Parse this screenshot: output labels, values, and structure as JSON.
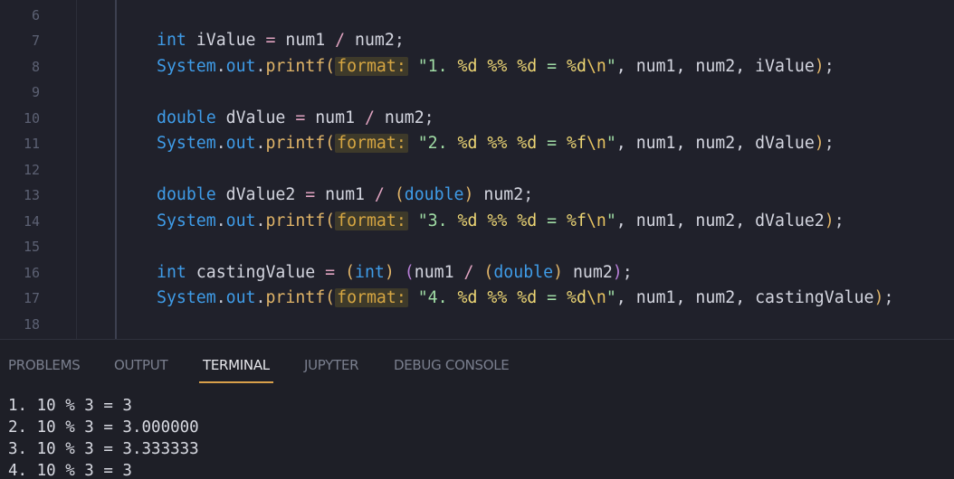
{
  "editor": {
    "lines": [
      {
        "num": "6",
        "tokens": []
      },
      {
        "num": "7",
        "tokens": [
          {
            "t": "int",
            "c": "kw"
          },
          {
            "t": " iValue ",
            "c": "var"
          },
          {
            "t": "=",
            "c": "op"
          },
          {
            "t": " num1 ",
            "c": "var"
          },
          {
            "t": "/",
            "c": "op"
          },
          {
            "t": " num2",
            "c": "var"
          },
          {
            "t": ";",
            "c": "plain"
          }
        ]
      },
      {
        "num": "8",
        "tokens": [
          {
            "t": "System",
            "c": "kw"
          },
          {
            "t": ".",
            "c": "plain"
          },
          {
            "t": "out",
            "c": "kw"
          },
          {
            "t": ".",
            "c": "plain"
          },
          {
            "t": "printf",
            "c": "method"
          },
          {
            "t": "(",
            "c": "p1"
          },
          {
            "t": "format:",
            "c": "hint"
          },
          {
            "t": " ",
            "c": "plain"
          },
          {
            "t": "\"1. ",
            "c": "str"
          },
          {
            "t": "%d",
            "c": "fmt"
          },
          {
            "t": " ",
            "c": "str"
          },
          {
            "t": "%%",
            "c": "fmt"
          },
          {
            "t": " ",
            "c": "str"
          },
          {
            "t": "%d",
            "c": "fmt"
          },
          {
            "t": " = ",
            "c": "str"
          },
          {
            "t": "%d",
            "c": "fmt"
          },
          {
            "t": "\\n",
            "c": "esc"
          },
          {
            "t": "\"",
            "c": "str"
          },
          {
            "t": ", num1, num2, iValue",
            "c": "var"
          },
          {
            "t": ")",
            "c": "p1"
          },
          {
            "t": ";",
            "c": "plain"
          }
        ]
      },
      {
        "num": "9",
        "tokens": []
      },
      {
        "num": "10",
        "tokens": [
          {
            "t": "double",
            "c": "kw"
          },
          {
            "t": " dValue ",
            "c": "var"
          },
          {
            "t": "=",
            "c": "op"
          },
          {
            "t": " num1 ",
            "c": "var"
          },
          {
            "t": "/",
            "c": "op"
          },
          {
            "t": " num2",
            "c": "var"
          },
          {
            "t": ";",
            "c": "plain"
          }
        ]
      },
      {
        "num": "11",
        "tokens": [
          {
            "t": "System",
            "c": "kw"
          },
          {
            "t": ".",
            "c": "plain"
          },
          {
            "t": "out",
            "c": "kw"
          },
          {
            "t": ".",
            "c": "plain"
          },
          {
            "t": "printf",
            "c": "method"
          },
          {
            "t": "(",
            "c": "p1"
          },
          {
            "t": "format:",
            "c": "hint"
          },
          {
            "t": " ",
            "c": "plain"
          },
          {
            "t": "\"2. ",
            "c": "str"
          },
          {
            "t": "%d",
            "c": "fmt"
          },
          {
            "t": " ",
            "c": "str"
          },
          {
            "t": "%%",
            "c": "fmt"
          },
          {
            "t": " ",
            "c": "str"
          },
          {
            "t": "%d",
            "c": "fmt"
          },
          {
            "t": " = ",
            "c": "str"
          },
          {
            "t": "%f",
            "c": "fmt"
          },
          {
            "t": "\\n",
            "c": "esc"
          },
          {
            "t": "\"",
            "c": "str"
          },
          {
            "t": ", num1, num2, dValue",
            "c": "var"
          },
          {
            "t": ")",
            "c": "p1"
          },
          {
            "t": ";",
            "c": "plain"
          }
        ]
      },
      {
        "num": "12",
        "tokens": []
      },
      {
        "num": "13",
        "tokens": [
          {
            "t": "double",
            "c": "kw"
          },
          {
            "t": " dValue2 ",
            "c": "var"
          },
          {
            "t": "=",
            "c": "op"
          },
          {
            "t": " num1 ",
            "c": "var"
          },
          {
            "t": "/",
            "c": "op"
          },
          {
            "t": " ",
            "c": "plain"
          },
          {
            "t": "(",
            "c": "p1"
          },
          {
            "t": "double",
            "c": "kw"
          },
          {
            "t": ")",
            "c": "p1"
          },
          {
            "t": " num2",
            "c": "var"
          },
          {
            "t": ";",
            "c": "plain"
          }
        ]
      },
      {
        "num": "14",
        "tokens": [
          {
            "t": "System",
            "c": "kw"
          },
          {
            "t": ".",
            "c": "plain"
          },
          {
            "t": "out",
            "c": "kw"
          },
          {
            "t": ".",
            "c": "plain"
          },
          {
            "t": "printf",
            "c": "method"
          },
          {
            "t": "(",
            "c": "p1"
          },
          {
            "t": "format:",
            "c": "hint"
          },
          {
            "t": " ",
            "c": "plain"
          },
          {
            "t": "\"3. ",
            "c": "str"
          },
          {
            "t": "%d",
            "c": "fmt"
          },
          {
            "t": " ",
            "c": "str"
          },
          {
            "t": "%%",
            "c": "fmt"
          },
          {
            "t": " ",
            "c": "str"
          },
          {
            "t": "%d",
            "c": "fmt"
          },
          {
            "t": " = ",
            "c": "str"
          },
          {
            "t": "%f",
            "c": "fmt"
          },
          {
            "t": "\\n",
            "c": "esc"
          },
          {
            "t": "\"",
            "c": "str"
          },
          {
            "t": ", num1, num2, dValue2",
            "c": "var"
          },
          {
            "t": ")",
            "c": "p1"
          },
          {
            "t": ";",
            "c": "plain"
          }
        ]
      },
      {
        "num": "15",
        "tokens": []
      },
      {
        "num": "16",
        "tokens": [
          {
            "t": "int",
            "c": "kw"
          },
          {
            "t": " castingValue ",
            "c": "var"
          },
          {
            "t": "=",
            "c": "op"
          },
          {
            "t": " ",
            "c": "plain"
          },
          {
            "t": "(",
            "c": "p1"
          },
          {
            "t": "int",
            "c": "kw"
          },
          {
            "t": ")",
            "c": "p1"
          },
          {
            "t": " ",
            "c": "plain"
          },
          {
            "t": "(",
            "c": "p2"
          },
          {
            "t": "num1 ",
            "c": "var"
          },
          {
            "t": "/",
            "c": "op"
          },
          {
            "t": " ",
            "c": "plain"
          },
          {
            "t": "(",
            "c": "p1"
          },
          {
            "t": "double",
            "c": "kw"
          },
          {
            "t": ")",
            "c": "p1"
          },
          {
            "t": " num2",
            "c": "var"
          },
          {
            "t": ")",
            "c": "p2"
          },
          {
            "t": ";",
            "c": "plain"
          }
        ]
      },
      {
        "num": "17",
        "tokens": [
          {
            "t": "System",
            "c": "kw"
          },
          {
            "t": ".",
            "c": "plain"
          },
          {
            "t": "out",
            "c": "kw"
          },
          {
            "t": ".",
            "c": "plain"
          },
          {
            "t": "printf",
            "c": "method"
          },
          {
            "t": "(",
            "c": "p1"
          },
          {
            "t": "format:",
            "c": "hint"
          },
          {
            "t": " ",
            "c": "plain"
          },
          {
            "t": "\"4. ",
            "c": "str"
          },
          {
            "t": "%d",
            "c": "fmt"
          },
          {
            "t": " ",
            "c": "str"
          },
          {
            "t": "%%",
            "c": "fmt"
          },
          {
            "t": " ",
            "c": "str"
          },
          {
            "t": "%d",
            "c": "fmt"
          },
          {
            "t": " = ",
            "c": "str"
          },
          {
            "t": "%d",
            "c": "fmt"
          },
          {
            "t": "\\n",
            "c": "esc"
          },
          {
            "t": "\"",
            "c": "str"
          },
          {
            "t": ", num1, num2, castingValue",
            "c": "var"
          },
          {
            "t": ")",
            "c": "p1"
          },
          {
            "t": ";",
            "c": "plain"
          }
        ]
      },
      {
        "num": "18",
        "tokens": []
      }
    ]
  },
  "panel": {
    "tabs": [
      {
        "label": "PROBLEMS",
        "active": false
      },
      {
        "label": "OUTPUT",
        "active": false
      },
      {
        "label": "TERMINAL",
        "active": true
      },
      {
        "label": "JUPYTER",
        "active": false
      },
      {
        "label": "DEBUG CONSOLE",
        "active": false
      }
    ],
    "terminal_lines": [
      "1. 10 % 3 = 3",
      "2. 10 % 3 = 3.000000",
      "3. 10 % 3 = 3.333333",
      "4. 10 % 3 = 3"
    ]
  },
  "colors": {
    "editor_bg": "#20212b",
    "panel_bg": "#1e1f27",
    "keyword": "#3f9ce8",
    "method": "#e0b468",
    "string": "#a0dca5",
    "format_spec": "#ecd574",
    "inlay_hint": "#d6a642",
    "active_tab_underline": "#d9a04a"
  }
}
